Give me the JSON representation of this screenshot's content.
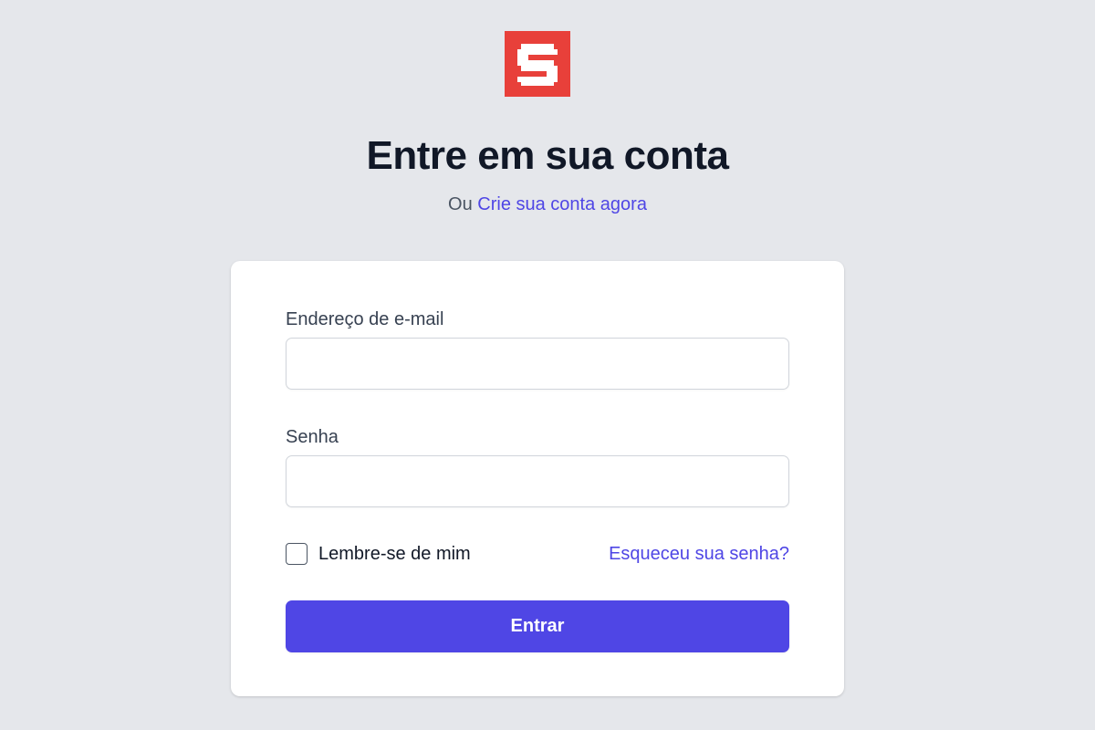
{
  "logo": {
    "icon": "pixel-s-logo-icon",
    "color": "#e8403a"
  },
  "heading": "Entre em sua conta",
  "subline": {
    "prefix": "Ou",
    "link_label": "Crie sua conta agora"
  },
  "form": {
    "email_label": "Endereço de e-mail",
    "email_value": "",
    "password_label": "Senha",
    "password_value": "",
    "remember_label": "Lembre-se de mim",
    "remember_checked": false,
    "forgot_label": "Esqueceu sua senha?",
    "submit_label": "Entrar"
  },
  "colors": {
    "background": "#e5e7eb",
    "accent": "#4f46e5",
    "heading": "#111827",
    "card": "#ffffff"
  }
}
